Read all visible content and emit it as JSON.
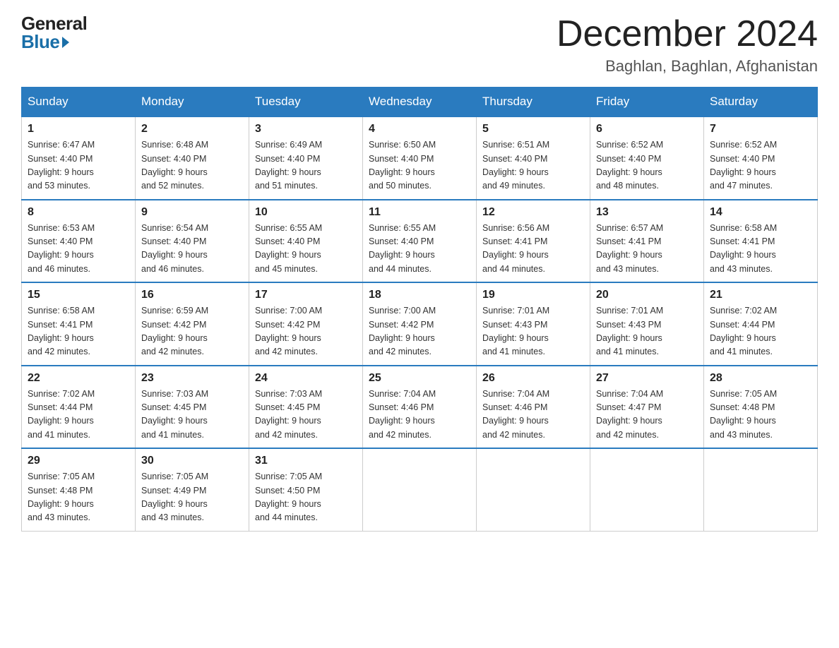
{
  "logo": {
    "general": "General",
    "blue": "Blue"
  },
  "title": "December 2024",
  "location": "Baghlan, Baghlan, Afghanistan",
  "days_of_week": [
    "Sunday",
    "Monday",
    "Tuesday",
    "Wednesday",
    "Thursday",
    "Friday",
    "Saturday"
  ],
  "weeks": [
    [
      {
        "day": "1",
        "sunrise": "6:47 AM",
        "sunset": "4:40 PM",
        "daylight": "9 hours and 53 minutes."
      },
      {
        "day": "2",
        "sunrise": "6:48 AM",
        "sunset": "4:40 PM",
        "daylight": "9 hours and 52 minutes."
      },
      {
        "day": "3",
        "sunrise": "6:49 AM",
        "sunset": "4:40 PM",
        "daylight": "9 hours and 51 minutes."
      },
      {
        "day": "4",
        "sunrise": "6:50 AM",
        "sunset": "4:40 PM",
        "daylight": "9 hours and 50 minutes."
      },
      {
        "day": "5",
        "sunrise": "6:51 AM",
        "sunset": "4:40 PM",
        "daylight": "9 hours and 49 minutes."
      },
      {
        "day": "6",
        "sunrise": "6:52 AM",
        "sunset": "4:40 PM",
        "daylight": "9 hours and 48 minutes."
      },
      {
        "day": "7",
        "sunrise": "6:52 AM",
        "sunset": "4:40 PM",
        "daylight": "9 hours and 47 minutes."
      }
    ],
    [
      {
        "day": "8",
        "sunrise": "6:53 AM",
        "sunset": "4:40 PM",
        "daylight": "9 hours and 46 minutes."
      },
      {
        "day": "9",
        "sunrise": "6:54 AM",
        "sunset": "4:40 PM",
        "daylight": "9 hours and 46 minutes."
      },
      {
        "day": "10",
        "sunrise": "6:55 AM",
        "sunset": "4:40 PM",
        "daylight": "9 hours and 45 minutes."
      },
      {
        "day": "11",
        "sunrise": "6:55 AM",
        "sunset": "4:40 PM",
        "daylight": "9 hours and 44 minutes."
      },
      {
        "day": "12",
        "sunrise": "6:56 AM",
        "sunset": "4:41 PM",
        "daylight": "9 hours and 44 minutes."
      },
      {
        "day": "13",
        "sunrise": "6:57 AM",
        "sunset": "4:41 PM",
        "daylight": "9 hours and 43 minutes."
      },
      {
        "day": "14",
        "sunrise": "6:58 AM",
        "sunset": "4:41 PM",
        "daylight": "9 hours and 43 minutes."
      }
    ],
    [
      {
        "day": "15",
        "sunrise": "6:58 AM",
        "sunset": "4:41 PM",
        "daylight": "9 hours and 42 minutes."
      },
      {
        "day": "16",
        "sunrise": "6:59 AM",
        "sunset": "4:42 PM",
        "daylight": "9 hours and 42 minutes."
      },
      {
        "day": "17",
        "sunrise": "7:00 AM",
        "sunset": "4:42 PM",
        "daylight": "9 hours and 42 minutes."
      },
      {
        "day": "18",
        "sunrise": "7:00 AM",
        "sunset": "4:42 PM",
        "daylight": "9 hours and 42 minutes."
      },
      {
        "day": "19",
        "sunrise": "7:01 AM",
        "sunset": "4:43 PM",
        "daylight": "9 hours and 41 minutes."
      },
      {
        "day": "20",
        "sunrise": "7:01 AM",
        "sunset": "4:43 PM",
        "daylight": "9 hours and 41 minutes."
      },
      {
        "day": "21",
        "sunrise": "7:02 AM",
        "sunset": "4:44 PM",
        "daylight": "9 hours and 41 minutes."
      }
    ],
    [
      {
        "day": "22",
        "sunrise": "7:02 AM",
        "sunset": "4:44 PM",
        "daylight": "9 hours and 41 minutes."
      },
      {
        "day": "23",
        "sunrise": "7:03 AM",
        "sunset": "4:45 PM",
        "daylight": "9 hours and 41 minutes."
      },
      {
        "day": "24",
        "sunrise": "7:03 AM",
        "sunset": "4:45 PM",
        "daylight": "9 hours and 42 minutes."
      },
      {
        "day": "25",
        "sunrise": "7:04 AM",
        "sunset": "4:46 PM",
        "daylight": "9 hours and 42 minutes."
      },
      {
        "day": "26",
        "sunrise": "7:04 AM",
        "sunset": "4:46 PM",
        "daylight": "9 hours and 42 minutes."
      },
      {
        "day": "27",
        "sunrise": "7:04 AM",
        "sunset": "4:47 PM",
        "daylight": "9 hours and 42 minutes."
      },
      {
        "day": "28",
        "sunrise": "7:05 AM",
        "sunset": "4:48 PM",
        "daylight": "9 hours and 43 minutes."
      }
    ],
    [
      {
        "day": "29",
        "sunrise": "7:05 AM",
        "sunset": "4:48 PM",
        "daylight": "9 hours and 43 minutes."
      },
      {
        "day": "30",
        "sunrise": "7:05 AM",
        "sunset": "4:49 PM",
        "daylight": "9 hours and 43 minutes."
      },
      {
        "day": "31",
        "sunrise": "7:05 AM",
        "sunset": "4:50 PM",
        "daylight": "9 hours and 44 minutes."
      },
      null,
      null,
      null,
      null
    ]
  ],
  "labels": {
    "sunrise": "Sunrise:",
    "sunset": "Sunset:",
    "daylight": "Daylight:"
  }
}
